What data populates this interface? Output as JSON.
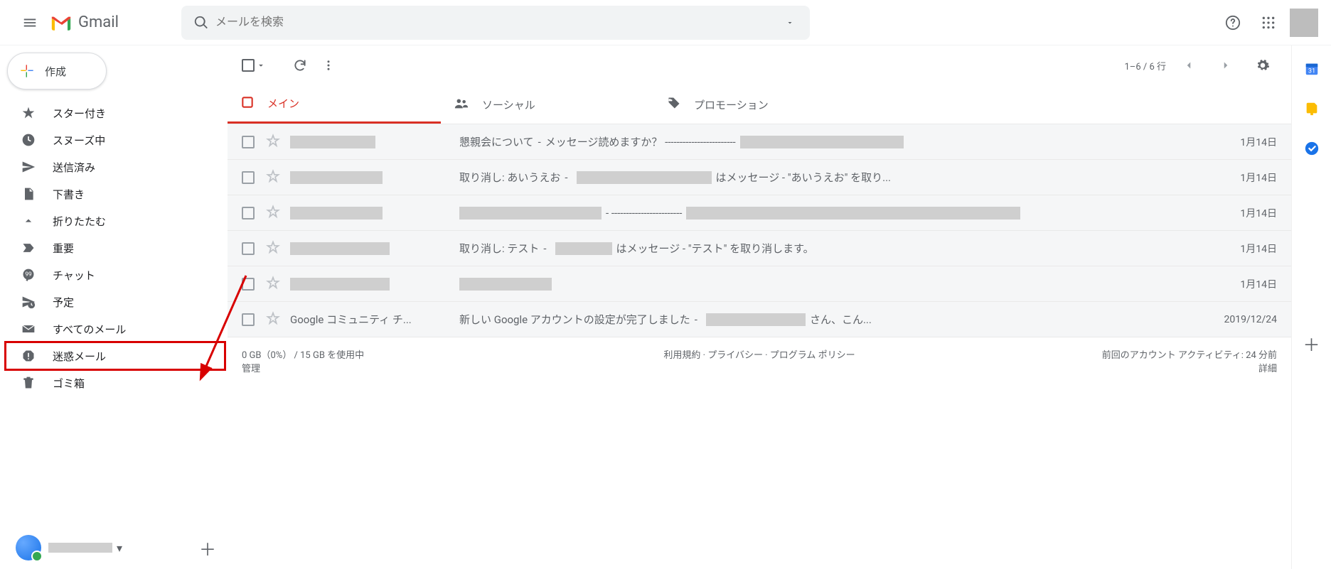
{
  "header": {
    "product": "Gmail",
    "search_placeholder": "メールを検索"
  },
  "compose": {
    "label": "作成"
  },
  "sidebar": {
    "items": [
      {
        "icon": "star",
        "label": "スター付き"
      },
      {
        "icon": "clock",
        "label": "スヌーズ中"
      },
      {
        "icon": "send",
        "label": "送信済み"
      },
      {
        "icon": "draft",
        "label": "下書き"
      },
      {
        "icon": "collapse",
        "label": "折りたたむ"
      },
      {
        "icon": "important",
        "label": "重要"
      },
      {
        "icon": "chat",
        "label": "チャット"
      },
      {
        "icon": "scheduled",
        "label": "予定"
      },
      {
        "icon": "all",
        "label": "すべてのメール"
      },
      {
        "icon": "spam",
        "label": "迷惑メール"
      },
      {
        "icon": "trash",
        "label": "ゴミ箱"
      }
    ],
    "highlight_index": 9
  },
  "toolbar": {
    "range": "1–6 / 6 行"
  },
  "tabs": [
    {
      "icon": "inbox",
      "label": "メイン",
      "active": true
    },
    {
      "icon": "people",
      "label": "ソーシャル"
    },
    {
      "icon": "tag",
      "label": "プロモーション"
    }
  ],
  "rows": [
    {
      "sender": "",
      "sender_redact_w": 120,
      "subject_before": "懇親会について",
      "sep": " - ",
      "subject_after": "メッセージ読めますか？ ------------------------",
      "redact_w": 230,
      "tail": "",
      "date": "1月14日"
    },
    {
      "sender": "",
      "sender_redact_w": 130,
      "subject_before": "取り消し: あいうえお",
      "sep": " - ",
      "subject_after": "",
      "redact_w": 190,
      "tail": "はメッセージ - \"あいうえお\" を取り...",
      "date": "1月14日"
    },
    {
      "sender": "",
      "sender_redact_w": 130,
      "subject_before": "",
      "sep": "",
      "subject_after": "",
      "field_redact": true,
      "redact1_w": 200,
      "mid_sep": " - ------------------------ ",
      "redact2_w": 470,
      "tail": "",
      "date": "1月14日"
    },
    {
      "sender": "",
      "sender_redact_w": 140,
      "subject_before": "取り消し: テスト",
      "sep": " - ",
      "subject_after": "",
      "redact_w": 80,
      "tail": " はメッセージ - \"テスト\" を取り消します。",
      "date": "1月14日"
    },
    {
      "sender": "",
      "sender_redact_w": 140,
      "subject_before": "",
      "sep": "",
      "subject_after": "",
      "redact_only": true,
      "redact_w": 130,
      "tail": "",
      "date": "1月14日"
    },
    {
      "sender": "Google コミュニティ チ...",
      "sender_redact_w": 0,
      "subject_before": "新しい Google アカウントの設定が完了しました",
      "sep": " - ",
      "subject_after": "",
      "redact_w": 140,
      "tail": " さん、こん...",
      "date": "2019/12/24"
    }
  ],
  "footer": {
    "storage": "0 GB（0%） / 15 GB を使用中",
    "manage": "管理",
    "policies": "利用規約 · プライバシー · プログラム ポリシー",
    "activity": "前回のアカウント アクティビティ: 24 分前",
    "details": "詳細"
  }
}
